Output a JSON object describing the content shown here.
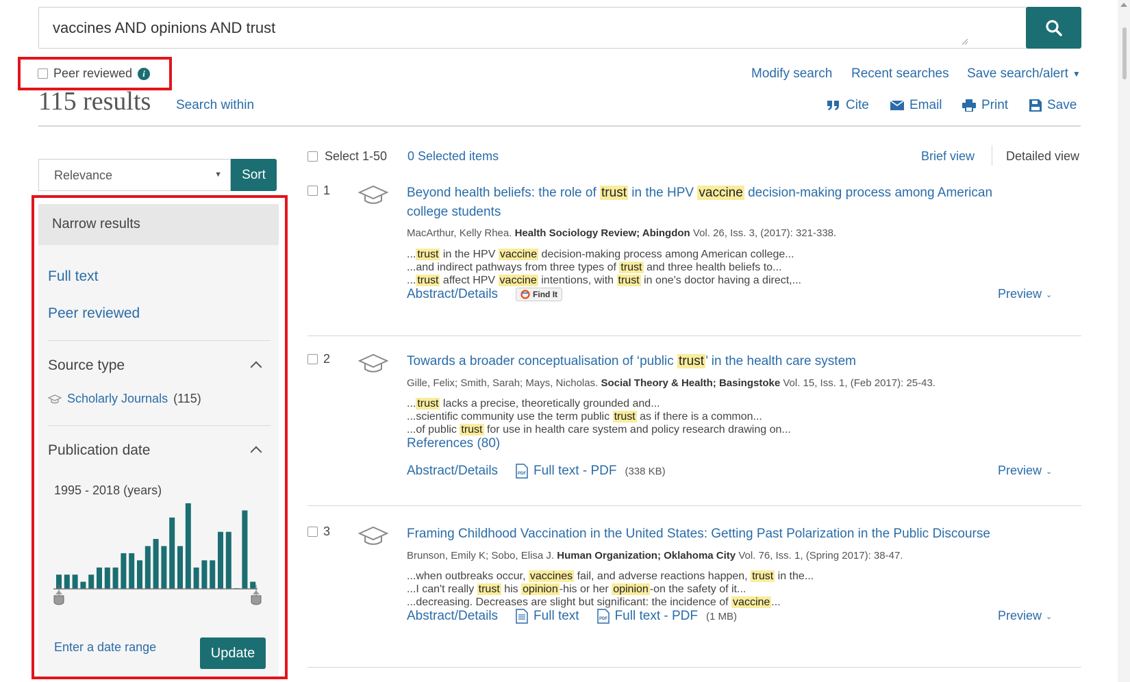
{
  "search": {
    "query": "vaccines AND opinions AND trust"
  },
  "filters": {
    "peer_reviewed_label": "Peer reviewed"
  },
  "results_summary": {
    "count_text": "115 results",
    "search_within": "Search within"
  },
  "top_links": {
    "modify_search": "Modify search",
    "recent_searches": "Recent searches",
    "save_search_alert": "Save search/alert"
  },
  "actions": {
    "cite": "Cite",
    "email": "Email",
    "print": "Print",
    "save": "Save"
  },
  "sort": {
    "selected": "Relevance",
    "button": "Sort"
  },
  "narrow": {
    "header": "Narrow results",
    "full_text": "Full text",
    "peer_reviewed": "Peer reviewed",
    "source_type_title": "Source type",
    "source_type_item": "Scholarly Journals",
    "source_type_count": "(115)",
    "pub_date_title": "Publication date",
    "date_range_text": "1995 - 2018 (years)",
    "enter_date_range": "Enter a date range",
    "update_button": "Update",
    "histogram_values": [
      2,
      2,
      2,
      1,
      2,
      3,
      3,
      3,
      5,
      5,
      4,
      6,
      7,
      6,
      10,
      6,
      12,
      3,
      4,
      4,
      8,
      8,
      0,
      11,
      1
    ]
  },
  "list_header": {
    "select_range": "Select 1-50",
    "selected_items": "0 Selected items",
    "brief_view": "Brief view",
    "detailed_view": "Detailed view"
  },
  "results": [
    {
      "num": "1",
      "title_parts": [
        "Beyond health beliefs: the role of ",
        "trust",
        " in the HPV ",
        "vaccine",
        " decision-making process among American college students"
      ],
      "authors": "MacArthur, Kelly Rhea.",
      "journal": "Health Sociology Review; Abingdon",
      "details": "Vol. 26, Iss. 3, (2017): 321-338.",
      "snippets": [
        [
          "...",
          "trust",
          " in the HPV ",
          "vaccine",
          " decision-making process among American college..."
        ],
        [
          "...and indirect pathways from three types of ",
          "trust",
          " and three health beliefs to..."
        ],
        [
          "...",
          "trust",
          " affect HPV ",
          "vaccine",
          " intentions, with ",
          "trust",
          " in one's doctor having a direct,..."
        ]
      ],
      "abstract_link": "Abstract/Details",
      "find_it": "Find It",
      "preview": "Preview"
    },
    {
      "num": "2",
      "title_parts": [
        "Towards a broader conceptualisation of ‘public ",
        "trust",
        "’ in the health care system"
      ],
      "authors": "Gille, Felix; Smith, Sarah; Mays, Nicholas.",
      "journal": "Social Theory & Health; Basingstoke",
      "details": "Vol. 15, Iss. 1, (Feb 2017): 25-43.",
      "snippets": [
        [
          "...",
          "trust",
          " lacks a precise, theoretically grounded and..."
        ],
        [
          "...scientific community use the term public ",
          "trust",
          " as if there is a common..."
        ],
        [
          "...of public ",
          "trust",
          " for use in health care system and policy research drawing on..."
        ]
      ],
      "references": "References (80)",
      "abstract_link": "Abstract/Details",
      "full_text_pdf": "Full text - PDF",
      "pdf_size": "(338 KB)",
      "preview": "Preview"
    },
    {
      "num": "3",
      "title_parts": [
        "Framing Childhood Vaccination in the United States: Getting Past Polarization in the Public Discourse"
      ],
      "authors": "Brunson, Emily K; Sobo, Elisa J.",
      "journal": "Human Organization; Oklahoma City",
      "details": "Vol. 76, Iss. 1, (Spring 2017): 38-47.",
      "snippets": [
        [
          "...when outbreaks occur, ",
          "vaccines",
          " fail, and adverse reactions happen, ",
          "trust",
          " in the..."
        ],
        [
          "...I can't really ",
          "trust",
          " his ",
          "opinion",
          "-his or her ",
          "opinion",
          "-on the safety of it..."
        ],
        [
          "...decreasing. Decreases are slight but significant: the incidence of ",
          "vaccine",
          "..."
        ]
      ],
      "abstract_link": "Abstract/Details",
      "full_text": "Full text",
      "full_text_pdf": "Full text - PDF",
      "pdf_size": "(1 MB)",
      "preview": "Preview"
    }
  ],
  "colors": {
    "accent": "#1b6e72",
    "link": "#2a6ca8",
    "highlight": "#f9ec9c",
    "annotation_red": "#e3141b"
  }
}
